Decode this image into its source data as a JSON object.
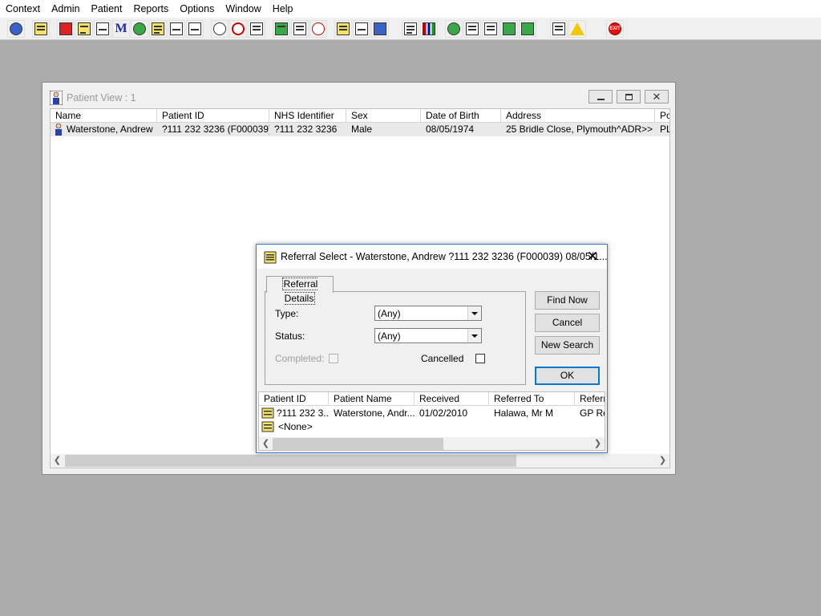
{
  "menubar": {
    "items": [
      "Context",
      "Admin",
      "Patient",
      "Reports",
      "Options",
      "Window",
      "Help"
    ]
  },
  "toolbar": {
    "icons": [
      "patient-doctor-icon",
      "printer-icon",
      "book-icon",
      "edit-notes-icon",
      "scanner-icon",
      "letter-m-icon",
      "nurse-icon",
      "notepad-icon",
      "handshake-icon",
      "camera-icon",
      "search-magnifier-icon",
      "clock-icon",
      "monitor-icon",
      "screen-list-icon",
      "form-icon",
      "gauge-icon",
      "notes-yellow-icon",
      "bed-icon",
      "ambulance-icon",
      "document-icon",
      "bar-chart-icon",
      "globe-icon",
      "check-form-icon",
      "approve-form-icon",
      "green-arrow-form-icon",
      "green-refresh-form-icon",
      "swap-arrows-icon",
      "warning-icon",
      "exit-icon"
    ]
  },
  "patient_view": {
    "title": "Patient View : 1",
    "columns": [
      "Name",
      "Patient ID",
      "NHS Identifier",
      "Sex",
      "Date of Birth",
      "Address",
      "Po"
    ],
    "rows": [
      {
        "name": "Waterstone, Andrew",
        "patient_id": "?111 232 3236 (F000039)",
        "nhs_identifier": "?111 232 3236",
        "sex": "Male",
        "dob": "08/05/1974",
        "address": "25 Bridle Close, Plymouth^ADR>>",
        "postcode": "PL"
      }
    ]
  },
  "referral_dialog": {
    "title": "Referral Select - Waterstone, Andrew ?111 232 3236 (F000039) 08/05/1...",
    "tab_label": "Referral Details",
    "type_label": "Type:",
    "type_value": "(Any)",
    "status_label": "Status:",
    "status_value": "(Any)",
    "completed_label": "Completed:",
    "cancelled_label": "Cancelled",
    "find_now_label": "Find Now",
    "cancel_label": "Cancel",
    "new_search_label": "New Search",
    "ok_label": "OK",
    "columns": [
      "Patient ID",
      "Patient Name",
      "Received",
      "Referred To",
      "Referra"
    ],
    "rows": [
      {
        "patient_id": "?111 232 3...",
        "patient_name": "Waterstone, Andr...",
        "received": "01/02/2010",
        "referred_to": "Halawa, Mr M",
        "referral": "GP Re"
      },
      {
        "patient_id": "<None>",
        "patient_name": "",
        "received": "",
        "referred_to": "",
        "referral": ""
      }
    ]
  }
}
